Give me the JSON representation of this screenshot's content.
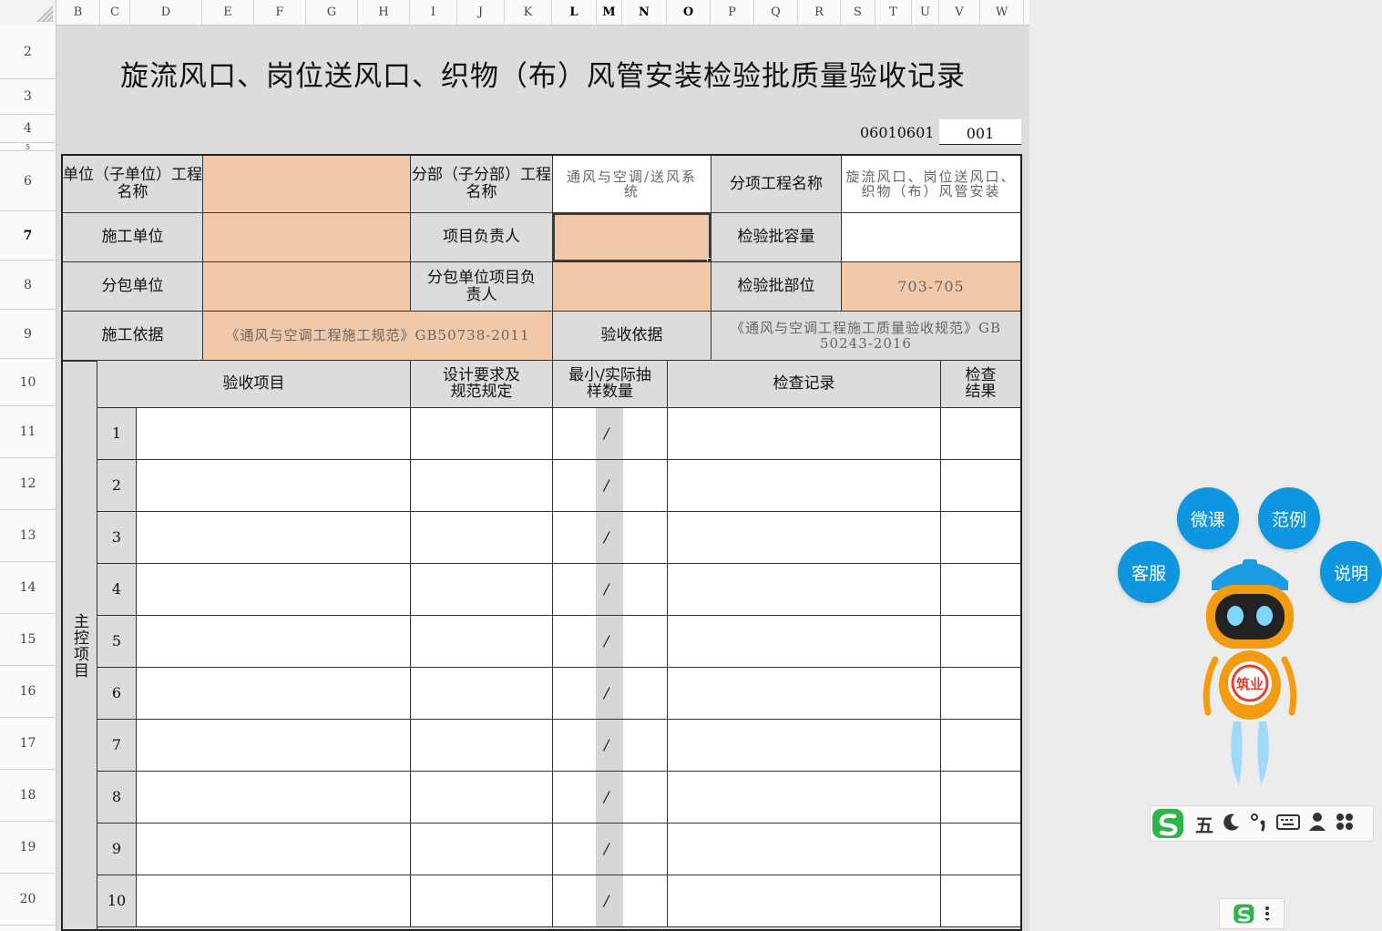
{
  "sheet": {
    "columns": [
      "B",
      "C",
      "D",
      "E",
      "F",
      "G",
      "H",
      "I",
      "J",
      "K",
      "L",
      "M",
      "N",
      "O",
      "P",
      "Q",
      "R",
      "S",
      "T",
      "U",
      "V",
      "W"
    ],
    "bold_columns": [
      "L",
      "M",
      "N",
      "O"
    ],
    "rows": [
      "2",
      "3",
      "4",
      "5",
      "6",
      "7",
      "8",
      "9",
      "10",
      "11",
      "12",
      "13",
      "14",
      "15",
      "16",
      "17",
      "18",
      "19",
      "20"
    ],
    "bold_rows": [
      "7"
    ]
  },
  "form": {
    "title": "旋流风口、岗位送风口、织物（布）风管安装检验批质量验收记录",
    "code": "06010601",
    "seq": "001",
    "labels": {
      "unit_name": "单位（子单位）工程名称",
      "division_name": "分部（子分部）工程名称",
      "subitem_name": "分项工程名称",
      "constructor": "施工单位",
      "project_lead": "项目负责人",
      "batch_capacity": "检验批容量",
      "subcontractor": "分包单位",
      "sub_lead": "分包单位项目负责人",
      "batch_location": "检验批部位",
      "construction_basis": "施工依据",
      "acceptance_basis": "验收依据"
    },
    "values": {
      "unit_name": "",
      "division_name": "通风与空调/送风系统",
      "subitem_name": "旋流风口、岗位送风口、织物（布）风管安装",
      "constructor": "",
      "project_lead": "",
      "batch_capacity": "",
      "subcontractor": "",
      "sub_lead": "",
      "batch_location": "703-705",
      "construction_basis": "《通风与空调工程施工规范》GB50738-2011",
      "acceptance_basis": "《通风与空调工程施工质量验收规范》GB 50243-2016"
    },
    "table_headers": {
      "item": "验收项目",
      "design": "设计要求及规范规定",
      "sample": "最小/实际抽样数量",
      "record": "检查记录",
      "result": "检查结果"
    },
    "section_label": "主控项目",
    "items": [
      {
        "no": "1",
        "sample": "/"
      },
      {
        "no": "2",
        "sample": "/"
      },
      {
        "no": "3",
        "sample": "/"
      },
      {
        "no": "4",
        "sample": "/"
      },
      {
        "no": "5",
        "sample": "/"
      },
      {
        "no": "6",
        "sample": "/"
      },
      {
        "no": "7",
        "sample": "/"
      },
      {
        "no": "8",
        "sample": "/"
      },
      {
        "no": "9",
        "sample": "/"
      },
      {
        "no": "10",
        "sample": "/"
      }
    ]
  },
  "assistant": {
    "buttons": [
      "微课",
      "范例",
      "客服",
      "说明"
    ],
    "badge": "筑业"
  },
  "ime": {
    "mode": "五",
    "items": [
      "moon-icon",
      "punctuation-icon",
      "keyboard-icon",
      "user-icon",
      "apps-icon"
    ]
  },
  "colors": {
    "peach": "#f2c9a8",
    "label_gray": "#dcdcdc",
    "bubble_blue": "#0e97e0",
    "ime_green": "#2fb44a"
  }
}
